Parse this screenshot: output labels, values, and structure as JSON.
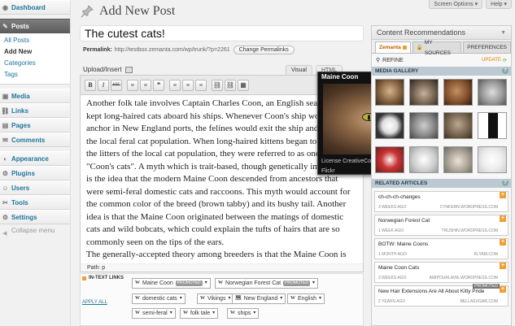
{
  "sidebar": {
    "dashboard": "Dashboard",
    "posts": "Posts",
    "posts_sub": [
      "All Posts",
      "Add New",
      "Categories",
      "Tags"
    ],
    "items": [
      "Media",
      "Links",
      "Pages",
      "Comments",
      "Appearance",
      "Plugins",
      "Users",
      "Tools",
      "Settings"
    ],
    "collapse": "Collapse menu"
  },
  "topbar": {
    "screen_options": "Screen Options ▾",
    "help": "Help ▾"
  },
  "page_title": "Add New Post",
  "post_title": "The cutest cats!",
  "permalink": {
    "label": "Permalink:",
    "url": "http://testbox.zemanta.com/wp/trunk/?p=2261",
    "button": "Change Permalinks"
  },
  "upload_label": "Upload/Insert",
  "editor_tabs": [
    "Visual",
    "HTML"
  ],
  "toolbar": [
    "B",
    "I",
    "ABC",
    "≡",
    "≡",
    "❝",
    "≡",
    "≡",
    "≡",
    "⛓",
    "⛓",
    "▦"
  ],
  "content": [
    "Another folk tale involves Captain Charles Coon, an English seafarer who kept long-haired cats aboard his ships. Whenever Coon's ship would anchor in New England ports, the felines would exit the ship and mate with the local feral cat population. When long-haired kittens began to appear in the litters of the local cat population, they were referred to as one of \"Coon's cats\". A myth which is trait-based, though genetically impossible, is the idea that the modern Maine Coon descended from ancestors that were semi-feral domestic cats and raccoons. This myth would account for the common color of the breed (brown tabby) and its bushy tail. Another idea is that the Maine Coon originated between the matings of domestic cats and wild bobcats, which could explain the tufts of hairs that are so commonly seen on the tips of the ears.",
    "The generally-accepted theory among breeders is that the Maine Coon is descended from the pairings of local short-haired domestic cats and long-haired breeds"
  ],
  "path": "Path: p",
  "popup": {
    "title": "Maine Coon",
    "license": "License CreativeCommons ShareAlike",
    "source": "Flickr"
  },
  "intext": {
    "label": "IN-TEXT LINKS",
    "apply_all": "APPLY ALL",
    "chips": [
      {
        "icon": "W",
        "text": "Maine Coon",
        "promoted": "PROMOTED"
      },
      {
        "icon": "W",
        "text": "Norwegian Forest Cat",
        "promoted": "PROMOTED"
      },
      {
        "icon": "W",
        "text": "domestic cats",
        "promoted": ""
      },
      {
        "icon": "W",
        "text": "Vikings",
        "promoted": ""
      },
      {
        "icon": "🗺",
        "text": "New England",
        "promoted": ""
      },
      {
        "icon": "W",
        "text": "English",
        "promoted": ""
      },
      {
        "icon": "W",
        "text": "semi-feral",
        "promoted": ""
      },
      {
        "icon": "W",
        "text": "folk tale",
        "promoted": ""
      },
      {
        "icon": "W",
        "text": "ships",
        "promoted": ""
      }
    ]
  },
  "zemanta": {
    "header": "Content Recommendations",
    "tabs": [
      "Zemanta",
      "MY SOURCES",
      "PREFERENCES"
    ],
    "refine": "REFINE",
    "update": "UPDATE",
    "media_gallery": "MEDIA GALLERY",
    "related_articles": "RELATED ARTICLES",
    "articles": [
      {
        "title": "ch-ch-ch-changes",
        "ago": "3 WEEKS AGO",
        "site": "CYNFERN.WORDPRESS.COM",
        "badge": ""
      },
      {
        "title": "Norwegian Forest Cat",
        "ago": "1 WEEK AGO",
        "site": "TRUSHIN.WORDPRESS.COM",
        "badge": ""
      },
      {
        "title": "BOTW: Maine Coons",
        "ago": "1 MONTH AGO",
        "site": "KLYAM.COM",
        "badge": ""
      },
      {
        "title": "Maine Coon Cats",
        "ago": "3 WEEKS AGO",
        "site": "AMIPOURLAVIE.WORDPRESS.COM",
        "badge": ""
      },
      {
        "title": "New Hair Extensions Are All About Kitty Pride",
        "ago": "2 YEARS AGO",
        "site": "BELLASUGAR.COM",
        "badge": "PROMOTED"
      }
    ]
  },
  "colors": {
    "accent": "#21759b",
    "zemanta_orange": "#f0a030",
    "active_menu": "#6d6d6d"
  }
}
